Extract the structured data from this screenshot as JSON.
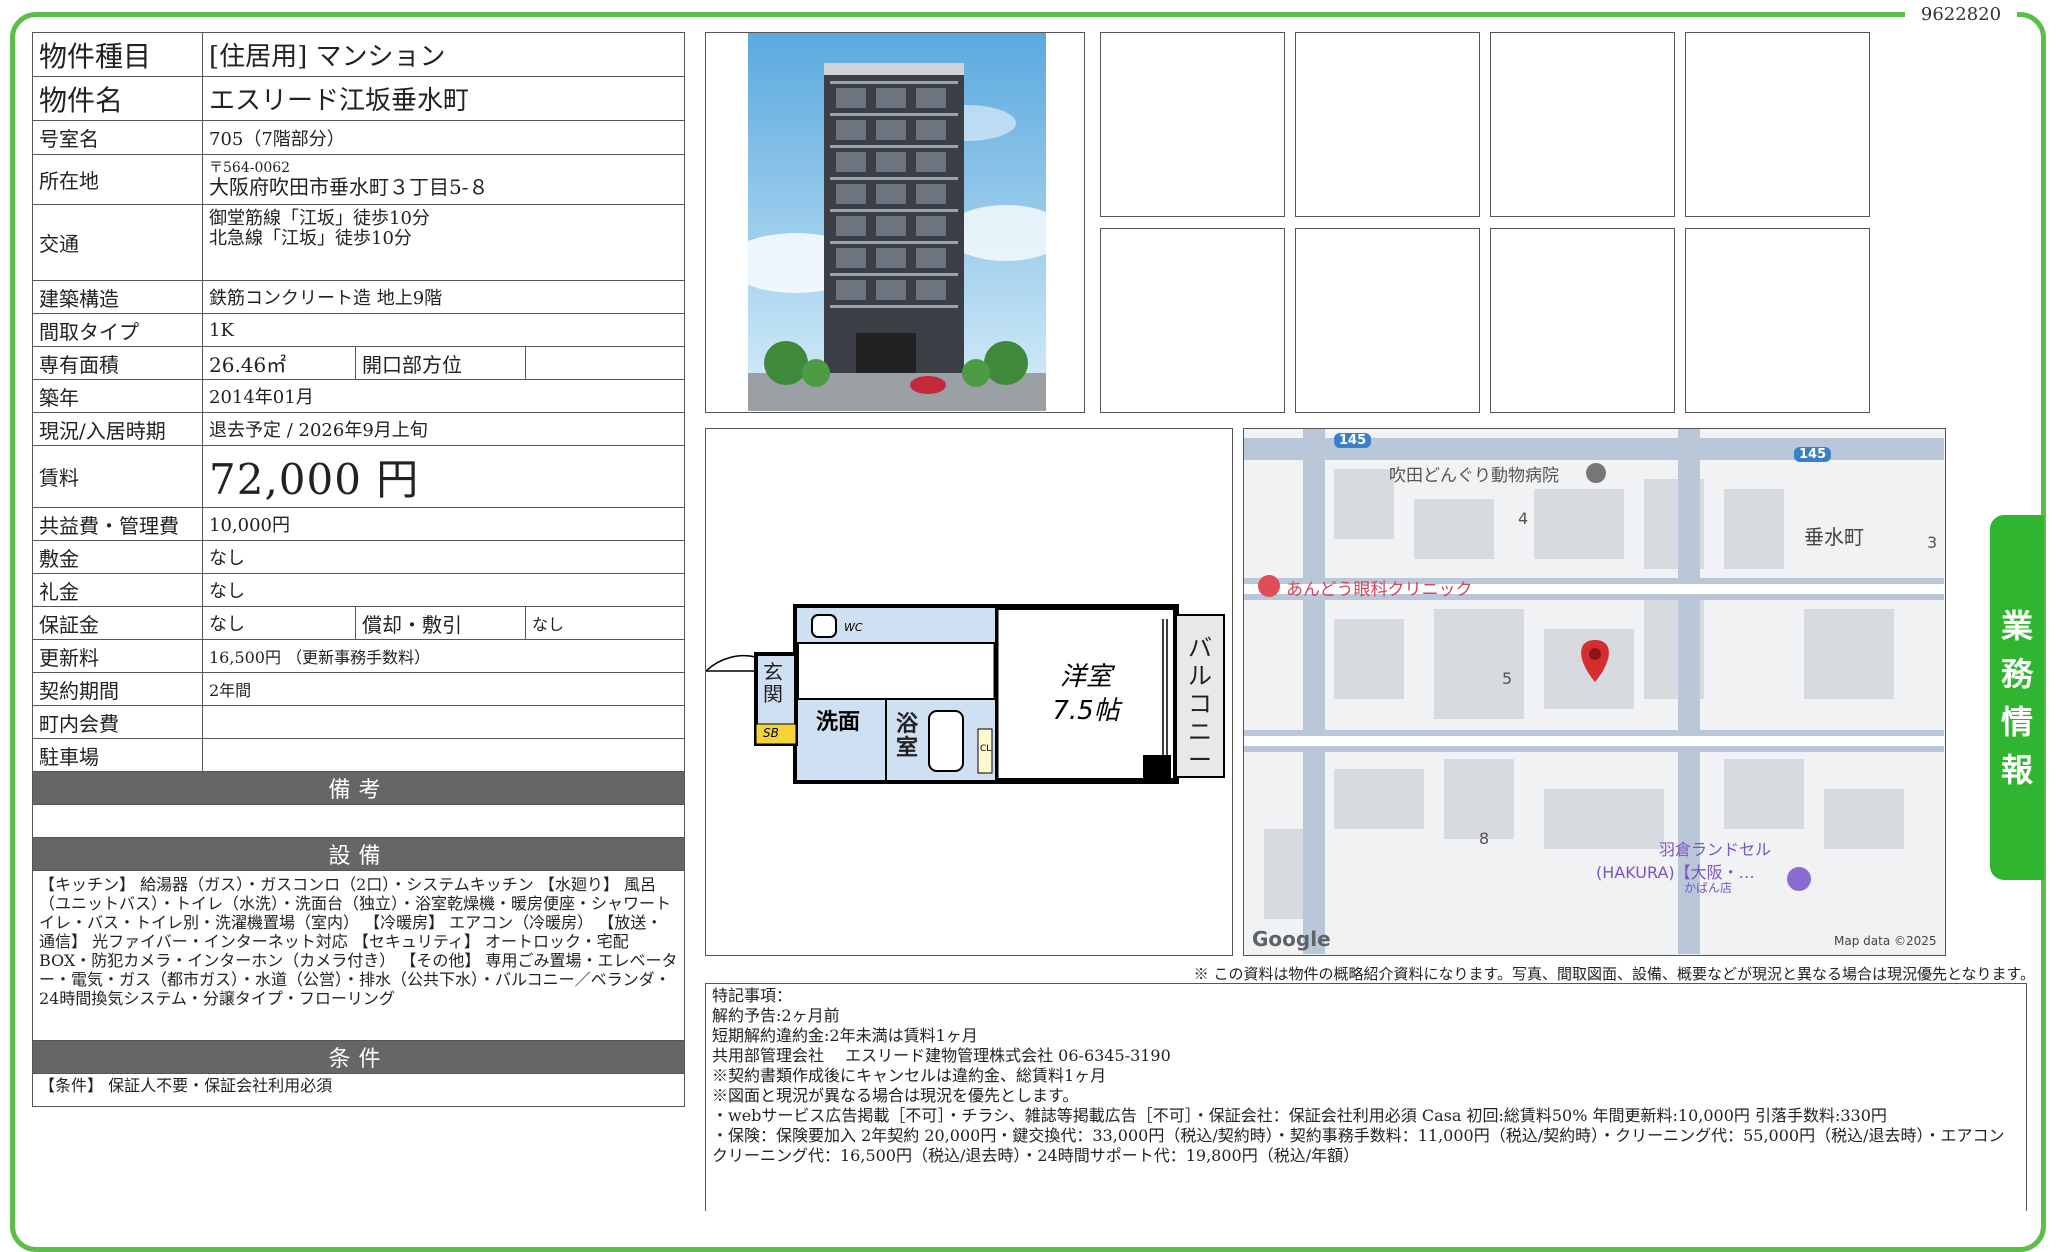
{
  "document_id": "9622820",
  "side_tab": [
    "業",
    "務",
    "情",
    "報"
  ],
  "property": {
    "type_label": "物件種目",
    "type_value": "[住居用]  マンション",
    "name_label": "物件名",
    "name_value": "エスリード江坂垂水町",
    "room_label": "号室名",
    "room_value": "705（7階部分）",
    "address_label": "所在地",
    "postal": "〒564-0062",
    "address_value": "大阪府吹田市垂水町３丁目5-８",
    "transport_label": "交通",
    "transport_1": "御堂筋線「江坂」徒歩10分",
    "transport_2": "北急線「江坂」徒歩10分",
    "structure_label": "建築構造",
    "structure_value": "鉄筋コンクリート造  地上9階",
    "layout_label": "間取タイプ",
    "layout_value": "1K",
    "area_label": "専有面積",
    "area_value": "26.46㎡",
    "direction_label": "開口部方位",
    "direction_value": "",
    "built_label": "築年",
    "built_value": "2014年01月",
    "status_label": "現況/入居時期",
    "status_value": "退去予定  /  2026年9月上旬",
    "rent_label": "賃料",
    "rent_value": "72,000 円",
    "fee_label": "共益費・管理費",
    "fee_value": "10,000円",
    "deposit_label": "敷金",
    "deposit_value": "なし",
    "key_money_label": "礼金",
    "key_money_value": "なし",
    "guarantee_label": "保証金",
    "guarantee_value": "なし",
    "amort_label": "償却・敷引",
    "amort_value": "なし",
    "renewal_label": "更新料",
    "renewal_value": "16,500円  （更新事務手数料）",
    "contract_label": "契約期間",
    "contract_value": "2年間",
    "neighborhood_label": "町内会費",
    "neighborhood_value": "",
    "parking_label": "駐車場",
    "parking_value": ""
  },
  "remarks_header": "備考",
  "remarks_text": "",
  "facilities_header": "設備",
  "facilities_text": "【キッチン】 給湯器（ガス）・ガスコンロ（2口）・システムキッチン 【水廻り】 風呂（ユニットバス）・トイレ（水洗）・洗面台（独立）・浴室乾燥機・暖房便座・シャワートイレ・バス・トイレ別・洗濯機置場（室内） 【冷暖房】 エアコン（冷暖房） 【放送・通信】 光ファイバー・インターネット対応 【セキュリティ】 オートロック・宅配BOX・防犯カメラ・インターホン（カメラ付き） 【その他】 専用ごみ置場・エレベーター・電気・ガス（都市ガス）・水道（公営）・排水（公共下水）・バルコニー／ベランダ・24時間換気システム・分譲タイプ・フローリング",
  "conditions_header": "条件",
  "conditions_text": "【条件】 保証人不要・保証会社利用必須",
  "floorplan": {
    "room_name": "洋室",
    "room_size": "7.5帖",
    "balcony": "バルコニー",
    "entrance": "玄関",
    "washroom": "洗面",
    "bath": "浴室",
    "wc": "WC",
    "sb": "SB",
    "cl": "CL"
  },
  "map": {
    "poi_1": "吹田どんぐり動物病院",
    "poi_2": "あんどう眼科クリニック",
    "poi_3": "羽倉ランドセル",
    "poi_3b": "(HAKURA)【大阪・…",
    "poi_3c": "かばん店",
    "area": "垂水町",
    "block_3": "3",
    "block_4": "4",
    "block_5": "5",
    "block_8": "8",
    "route": "145",
    "route_2": "145",
    "google": "Google",
    "attribution": "Map data ©2025"
  },
  "disclaimer": "※ この資料は物件の概略紹介資料になります。写真、間取図面、設備、概要などが現況と異なる場合は現況優先となります。",
  "notes": [
    "特記事項：",
    "解約予告:2ヶ月前",
    "短期解約違約金:2年未満は賃料1ヶ月",
    "共用部管理会社　 エスリード建物管理株式会社  06-6345-3190",
    "※契約書類作成後にキャンセルは違約金、総賃料1ヶ月",
    "※図面と現況が異なる場合は現況を優先とします。",
    "・webサービス広告掲載［不可］・チラシ、雑誌等掲載広告［不可］・保証会社：保証会社利用必須 Casa 初回:総賃料50%  年間更新料:10,000円   引落手数料:330円",
    "・保険：保険要加入 2年契約 20,000円・鍵交換代：33,000円（税込/契約時）・契約事務手数料：11,000円（税込/契約時）・クリーニング代：55,000円（税込/退去時）・エアコンクリーニング代：16,500円（税込/退去時）・24時間サポート代：19,800円（税込/年額）"
  ]
}
